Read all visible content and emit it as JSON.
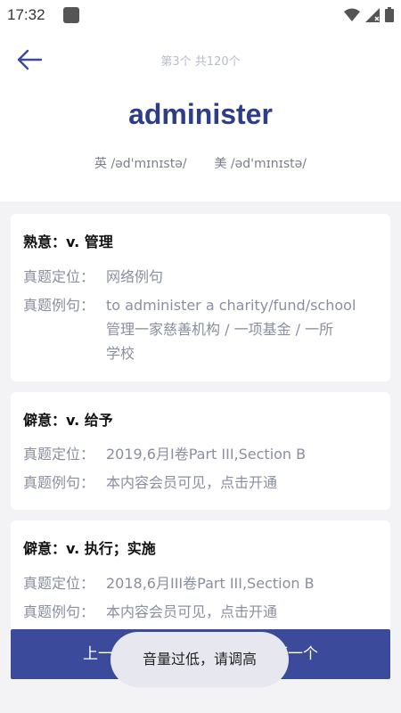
{
  "status": {
    "time": "17:32"
  },
  "header": {
    "counter": "第3个 共120个",
    "word": "administer",
    "uk_label": "英",
    "uk_ipa": "/əd'mɪnɪstə/",
    "us_label": "美",
    "us_ipa": "/əd'mɪnɪstə/"
  },
  "cards": [
    {
      "title": "熟意：v. 管理",
      "position_label": "真题定位：",
      "position_value": "网络例句",
      "example_label": "真题例句：",
      "example_line1": "to administer a charity/fund/school",
      "example_line2": "管理一家慈善机构 / 一项基金 / 一所",
      "example_line3": "学校"
    },
    {
      "title": "僻意：v. 给予",
      "position_label": "真题定位：",
      "position_value": "2019,6月I卷Part III,Section B",
      "example_label": "真题例句：",
      "example_value": "本内容会员可见，点击开通"
    },
    {
      "title": "僻意：v. 执行；实施",
      "position_label": "真题定位：",
      "position_value": "2018,6月III卷Part III,Section B",
      "example_label": "真题例句：",
      "example_value": "本内容会员可见，点击开通"
    }
  ],
  "bottom": {
    "prev_label": "上一个",
    "next_label": "下一个"
  },
  "toast": {
    "text": "音量过低，请调高"
  },
  "colors": {
    "accent": "#3b4a9a",
    "word": "#2e3d8a",
    "muted": "#8a8fa0"
  }
}
